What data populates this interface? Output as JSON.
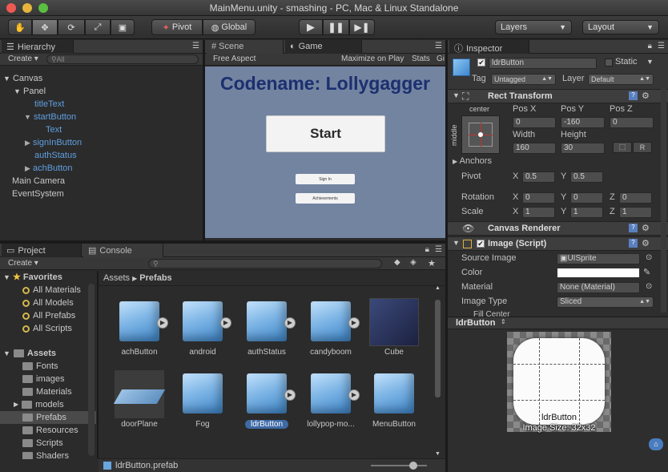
{
  "window": {
    "title": "MainMenu.unity - smashing - PC, Mac & Linux Standalone"
  },
  "toolbar": {
    "pivot_label": "Pivot",
    "global_label": "Global",
    "layers_label": "Layers",
    "layout_label": "Layout"
  },
  "hierarchy": {
    "tab": "Hierarchy",
    "create": "Create",
    "search_placeholder": "All",
    "items": [
      {
        "label": "Canvas"
      },
      {
        "label": "Panel"
      },
      {
        "label": "titleText"
      },
      {
        "label": "startButton"
      },
      {
        "label": "Text"
      },
      {
        "label": "signInButton"
      },
      {
        "label": "authStatus"
      },
      {
        "label": "achButton"
      },
      {
        "label": "Main Camera"
      },
      {
        "label": "EventSystem"
      }
    ]
  },
  "scene": {
    "scene_tab": "Scene",
    "game_tab": "Game",
    "aspect": "Free Aspect",
    "maximize": "Maximize on Play",
    "stats": "Stats",
    "gizmos": "Gi"
  },
  "game": {
    "title": "Codename: Lollygagger",
    "start": "Start",
    "signin": "Sign In",
    "achievements": "Achievements"
  },
  "project": {
    "tab": "Project",
    "console_tab": "Console",
    "create": "Create",
    "favorites": "Favorites",
    "fav_items": [
      "All Materials",
      "All Models",
      "All Prefabs",
      "All Scripts"
    ],
    "assets": "Assets",
    "folders": [
      "Fonts",
      "images",
      "Materials",
      "models",
      "Prefabs",
      "Resources",
      "Scripts",
      "Shaders"
    ],
    "breadcrumb_root": "Assets",
    "breadcrumb_leaf": "Prefabs",
    "items": [
      "achButton",
      "android",
      "authStatus",
      "candyboom",
      "Cube",
      "doorPlane",
      "Fog",
      "ldrButton",
      "lollypop-mo...",
      "MenuButton"
    ],
    "footer": "ldrButton.prefab"
  },
  "inspector": {
    "tab": "Inspector",
    "name": "ldrButton",
    "static": "Static",
    "tag_label": "Tag",
    "tag_value": "Untagged",
    "layer_label": "Layer",
    "layer_value": "Default",
    "rect_transform": "Rect Transform",
    "anchor_h": "center",
    "anchor_v": "middle",
    "pos_x_label": "Pos X",
    "pos_y_label": "Pos Y",
    "pos_z_label": "Pos Z",
    "pos_x": "0",
    "pos_y": "-160",
    "pos_z": "0",
    "width_label": "Width",
    "height_label": "Height",
    "width": "160",
    "height": "30",
    "r_button": "R",
    "anchors": "Anchors",
    "pivot_label": "Pivot",
    "pivot_x": "0.5",
    "pivot_y": "0.5",
    "rotation_label": "Rotation",
    "rot_x": "0",
    "rot_y": "0",
    "rot_z": "0",
    "scale_label": "Scale",
    "scale_x": "1",
    "scale_y": "1",
    "scale_z": "1",
    "x": "X",
    "y": "Y",
    "z": "Z",
    "canvas_renderer": "Canvas Renderer",
    "image_script": "Image (Script)",
    "source_image_label": "Source Image",
    "source_image": "UISprite",
    "color_label": "Color",
    "material_label": "Material",
    "material": "None (Material)",
    "image_type_label": "Image Type",
    "image_type": "Sliced",
    "fill_center": "Fill Center"
  },
  "preview": {
    "title": "ldrButton",
    "name": "ldrButton",
    "size": "Image Size: 32x32"
  }
}
